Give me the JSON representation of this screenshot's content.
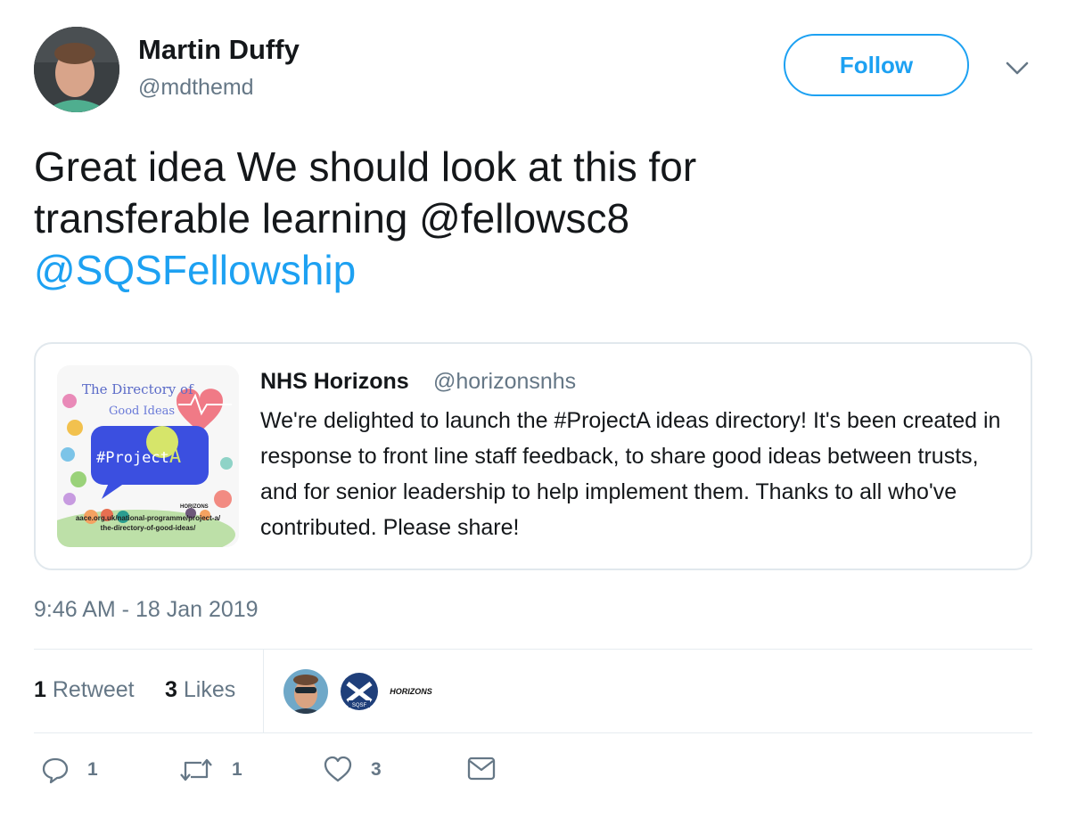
{
  "author": {
    "display_name": "Martin Duffy",
    "handle": "@mdthemd",
    "avatar_icon": "avatar-photo"
  },
  "follow_button": {
    "label": "Follow",
    "color": "#1da1f2"
  },
  "menu_icon": "chevron-down-icon",
  "tweet": {
    "text_line1": "Great idea We should look at this for",
    "text_line2_prefix": "transferable learning @fellowsc8",
    "mention": "@SQSFellowship",
    "mention_color": "#1da1f2"
  },
  "quoted_tweet": {
    "display_name": "NHS Horizons",
    "handle": "@horizonsnhs",
    "text": "We're delighted to launch the #ProjectA ideas directory! It's been created in response to front line staff feedback, to share good ideas between trusts, and for senior leadership to help implement them. Thanks to all who've contributed. Please share!",
    "image": {
      "line1": "The Directory of",
      "line2": "Good Ideas",
      "badge": "#Project",
      "badge_letter": "A",
      "url_line1": "aace.org.uk/national-programme/project-a/",
      "url_line2": "the-directory-of-good-ideas/",
      "logos_text": "HORIZONS"
    }
  },
  "timestamp": "9:46 AM - 18 Jan 2019",
  "stats": {
    "retweets_count": "1",
    "retweets_label": "Retweet",
    "likes_count": "3",
    "likes_label": "Likes"
  },
  "likers": [
    {
      "name": "liker-avatar-person"
    },
    {
      "name": "liker-avatar-sqsf",
      "label": "SQSF"
    },
    {
      "name": "liker-avatar-horizons",
      "label": "HORIZONS"
    }
  ],
  "actions": {
    "reply_count": "1",
    "retweet_count": "1",
    "like_count": "3"
  }
}
